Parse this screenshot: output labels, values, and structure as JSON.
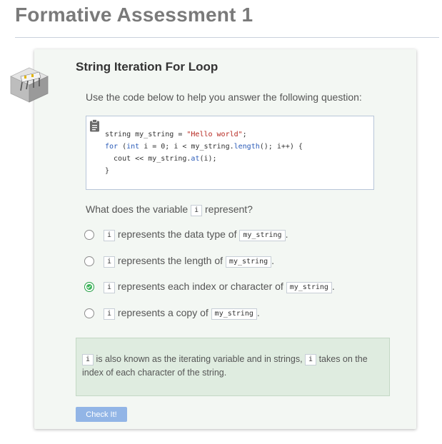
{
  "page": {
    "title": "Formative Assessment 1"
  },
  "card": {
    "title": "String Iteration For Loop",
    "instruction": "Use the code below to help you answer the following question:",
    "code": {
      "line1_a": "string my_string = ",
      "line1_str": "\"Hello world\"",
      "line1_b": ";",
      "line2_kw1": "for",
      "line2_a": " (",
      "line2_kw2": "int",
      "line2_b": " i = 0; i < my_string.",
      "line2_kw3": "length",
      "line2_c": "(); i++) {",
      "line3_a": "  cout << my_string.",
      "line3_kw": "at",
      "line3_b": "(i);",
      "line4": "}"
    },
    "question": {
      "before": "What does the variable",
      "code": "i",
      "after": "represent?"
    },
    "options": [
      {
        "code1": "i",
        "text": "represents the data type of",
        "code2": "my_string",
        "end": ".",
        "selected": false
      },
      {
        "code1": "i",
        "text": "represents the length of",
        "code2": "my_string",
        "end": ".",
        "selected": false
      },
      {
        "code1": "i",
        "text": "represents each index or character of",
        "code2": "my_string",
        "end": ".",
        "selected": true
      },
      {
        "code1": "i",
        "text": "represents a copy of",
        "code2": "my_string",
        "end": ".",
        "selected": false
      }
    ],
    "feedback": {
      "code1": "i",
      "text1": "is also known as the iterating variable and in strings,",
      "code2": "i",
      "text2": "takes on the index of each character of the string."
    },
    "check_button": "Check It!"
  },
  "icons": {
    "logo": "codio-bridge-cube-icon",
    "clipboard": "clipboard-icon",
    "check": "check-icon"
  },
  "colors": {
    "card_bg": "#f3f7f3",
    "feedback_bg": "#dfece0",
    "button_bg": "#92b5e6",
    "selected_radio": "#3cb55a"
  }
}
